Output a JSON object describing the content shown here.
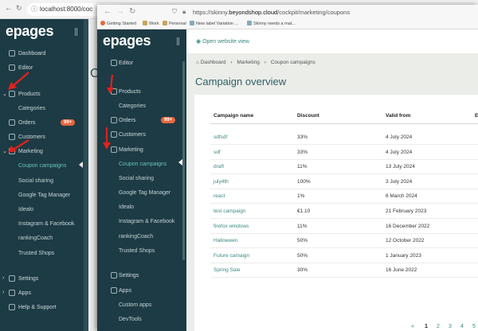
{
  "back_window": {
    "url": "localhost:8000/coc",
    "logo": "epages",
    "nav": [
      {
        "label": "Dashboard",
        "icon": "home-icon"
      },
      {
        "label": "Editor",
        "icon": "editor-icon"
      },
      {
        "label": "Products",
        "icon": "tag-icon"
      },
      {
        "label": "Categories"
      },
      {
        "label": "Orders",
        "icon": "orders-icon",
        "badge": "99+"
      },
      {
        "label": "Customers",
        "icon": "user-icon"
      },
      {
        "label": "Marketing",
        "icon": "megaphone-icon"
      },
      {
        "label": "Coupon campaigns"
      },
      {
        "label": "Social sharing"
      },
      {
        "label": "Google Tag Manager"
      },
      {
        "label": "Idealo"
      },
      {
        "label": "Instagram & Facebook"
      },
      {
        "label": "rankingCoach"
      },
      {
        "label": "Trusted Shops"
      },
      {
        "label": "Settings",
        "icon": "gear-icon"
      },
      {
        "label": "Apps",
        "icon": "apps-icon"
      },
      {
        "label": "Help & Support",
        "icon": "help-icon"
      }
    ],
    "main_fragment": "C"
  },
  "front_window": {
    "url_prefix": "https://skinny.",
    "url_domain": "beyondshop.cloud",
    "url_path": "/cockpit/marketing/coupons",
    "bookmarks": [
      "Getting Started",
      "Work",
      "Personal",
      "New label Variation ...",
      "Skinny needs a mat..."
    ],
    "logo": "epages",
    "nav": [
      {
        "label": "Editor",
        "icon": "editor-icon"
      },
      {
        "label": "Products",
        "icon": "tag-icon"
      },
      {
        "label": "Categories"
      },
      {
        "label": "Orders",
        "icon": "orders-icon",
        "badge": "99+"
      },
      {
        "label": "Customers",
        "icon": "user-icon"
      },
      {
        "label": "Marketing",
        "icon": "megaphone-icon"
      },
      {
        "label": "Coupon campaigns"
      },
      {
        "label": "Social sharing"
      },
      {
        "label": "Google Tag Manager"
      },
      {
        "label": "Idealo"
      },
      {
        "label": "Instagram & Facebook"
      },
      {
        "label": "rankingCoach"
      },
      {
        "label": "Trusted Shops"
      },
      {
        "label": "Settings",
        "icon": "gear-icon"
      },
      {
        "label": "Apps",
        "icon": "apps-icon"
      },
      {
        "label": "Custom apps"
      },
      {
        "label": "DevTools"
      }
    ],
    "open_website": "Open website view",
    "breadcrumb": [
      "Dashboard",
      "Marketing",
      "Coupon campaigns"
    ],
    "page_title": "Campaign overview",
    "table": {
      "headers": [
        "Campaign name",
        "Discount",
        "Valid from",
        "E"
      ],
      "rows": [
        {
          "name": "sdfsdf",
          "discount": "33%",
          "valid_from": "4 July 2024"
        },
        {
          "name": "sdf",
          "discount": "33%",
          "valid_from": "4 July 2024"
        },
        {
          "name": "draft",
          "discount": "11%",
          "valid_from": "13 July 2024"
        },
        {
          "name": "july4th",
          "discount": "100%",
          "valid_from": "3 July 2024"
        },
        {
          "name": "react",
          "discount": "1%",
          "valid_from": "6 March 2024"
        },
        {
          "name": "test campaign",
          "discount": "€1.10",
          "valid_from": "21 February 2023"
        },
        {
          "name": "firefox windows",
          "discount": "11%",
          "valid_from": "16 December 2022"
        },
        {
          "name": "Halloween",
          "discount": "50%",
          "valid_from": "12 October 2022"
        },
        {
          "name": "Future camaign",
          "discount": "50%",
          "valid_from": "1 January 2023"
        },
        {
          "name": "Spring Sale",
          "discount": "30%",
          "valid_from": "16 June 2022"
        }
      ]
    },
    "pagination": {
      "prev": "«",
      "pages": [
        "1",
        "2",
        "3",
        "4",
        "5"
      ],
      "current": "1"
    }
  },
  "colors": {
    "sidebar_bg": "#1d3b45",
    "accent": "#3a8a82",
    "active_nav": "#66c2b8",
    "badge": "#e8673f",
    "annotation_arrow": "#e0211c"
  }
}
